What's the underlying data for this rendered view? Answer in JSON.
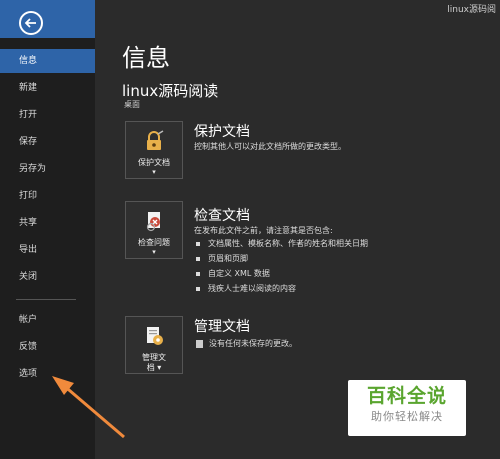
{
  "window": {
    "title_fragment": "linux源码阅"
  },
  "sidebar": {
    "items": [
      {
        "label": "信息",
        "active": true
      },
      {
        "label": "新建"
      },
      {
        "label": "打开"
      },
      {
        "label": "保存"
      },
      {
        "label": "另存为"
      },
      {
        "label": "打印"
      },
      {
        "label": "共享"
      },
      {
        "label": "导出"
      },
      {
        "label": "关闭"
      }
    ],
    "bottom_items": [
      {
        "label": "帐户"
      },
      {
        "label": "反馈"
      },
      {
        "label": "选项"
      }
    ]
  },
  "main": {
    "title": "信息",
    "doc_name": "linux源码阅读",
    "doc_location": "桌面",
    "sections": [
      {
        "tile_label": "保护文档",
        "title": "保护文档",
        "desc": "控制其他人可以对此文档所做的更改类型。"
      },
      {
        "tile_label": "检查问题",
        "title": "检查文档",
        "desc": "在发布此文件之前，请注意其是否包含:",
        "bullets": [
          "文档属性、模板名称、作者的姓名和相关日期",
          "页眉和页脚",
          "自定义 XML 数据",
          "残疾人士难以阅读的内容"
        ]
      },
      {
        "tile_label_1": "管理文",
        "tile_label_2": "档",
        "title": "管理文档",
        "desc": "没有任何未保存的更改。"
      }
    ]
  },
  "watermark": {
    "main": "百科全说",
    "sub": "助你轻松解决"
  },
  "colors": {
    "accent": "#2e64a8",
    "arrow": "#f08a3c",
    "watermark_green": "#5aa52f"
  }
}
